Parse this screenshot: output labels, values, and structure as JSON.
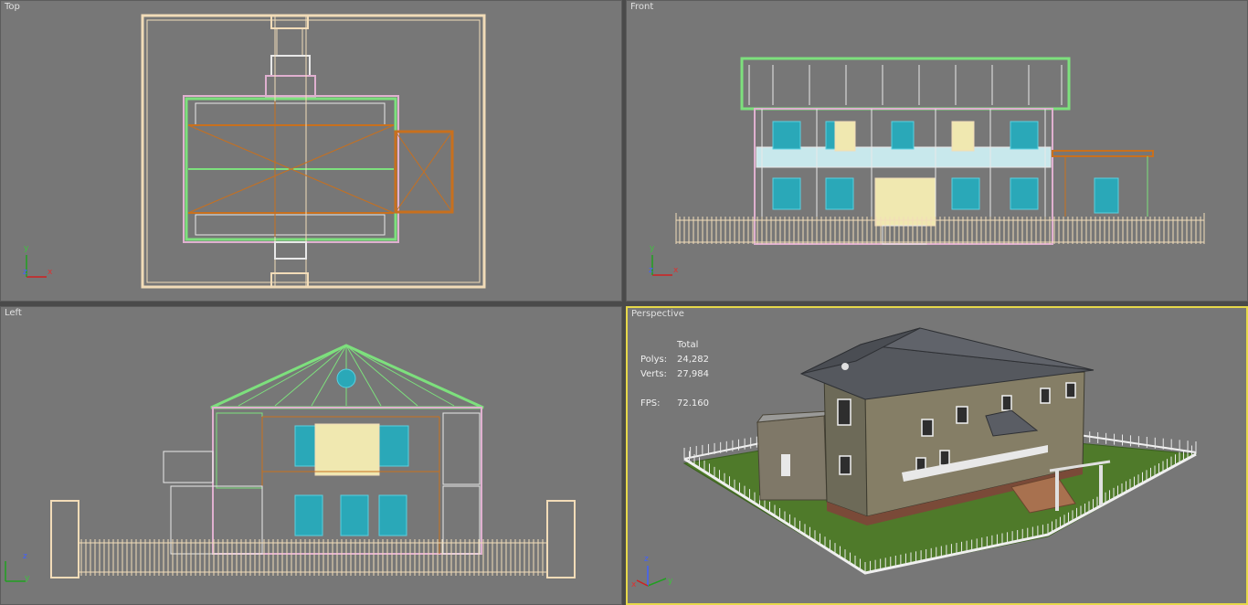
{
  "viewports": {
    "top": {
      "label": "Top"
    },
    "front": {
      "label": "Front"
    },
    "left": {
      "label": "Left"
    },
    "perspective": {
      "label": "Perspective"
    }
  },
  "stats": {
    "header": "Total",
    "polys_label": "Polys:",
    "polys_value": "24,282",
    "verts_label": "Verts:",
    "verts_value": "27,984",
    "fps_label": "FPS:",
    "fps_value": "72.160"
  },
  "axes": {
    "x": "x",
    "y": "y",
    "z": "z"
  },
  "colors": {
    "viewport_bg": "#777777",
    "active_border": "#e6d84a",
    "wire_cream": "#f2dcb8",
    "wire_green": "#7de07d",
    "wire_cyan": "#4ec9d6",
    "wire_orange": "#c8701e",
    "wire_pink": "#e0b0d0",
    "wire_white": "#e8e8e8"
  }
}
